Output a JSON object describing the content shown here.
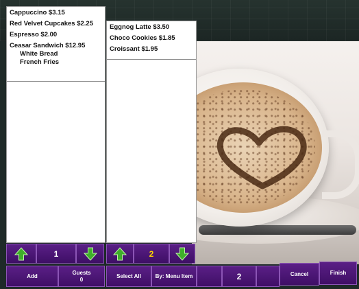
{
  "left_ticket": {
    "items": [
      {
        "text": "Cappuccino $3.15",
        "modifiers": []
      },
      {
        "text": "Red Velvet Cupcakes $2.25",
        "modifiers": []
      },
      {
        "text": "Espresso $2.00",
        "modifiers": []
      },
      {
        "text": "Ceasar Sandwich $12.95",
        "modifiers": [
          "White Bread",
          "French Fries"
        ]
      }
    ],
    "page": "1"
  },
  "right_ticket": {
    "items": [
      {
        "text": "Eggnog Latte $3.50"
      },
      {
        "text": "Choco Cookies $1.85"
      },
      {
        "text": "Croissant $1.95"
      }
    ],
    "page": "2"
  },
  "toolbar": {
    "add": "Add",
    "guests_label": "Guests",
    "guests_count": "0",
    "select_all": "Select All",
    "by_menu_item": "By: Menu Item",
    "seat_number": "2",
    "cancel": "Cancel",
    "finish": "Finish"
  },
  "icons": {
    "up": "arrow-up-icon",
    "down": "arrow-down-icon"
  },
  "colors": {
    "button_bg": "#4a1575",
    "arrow_green": "#3fae2a",
    "page_highlight": "#ffd400"
  }
}
